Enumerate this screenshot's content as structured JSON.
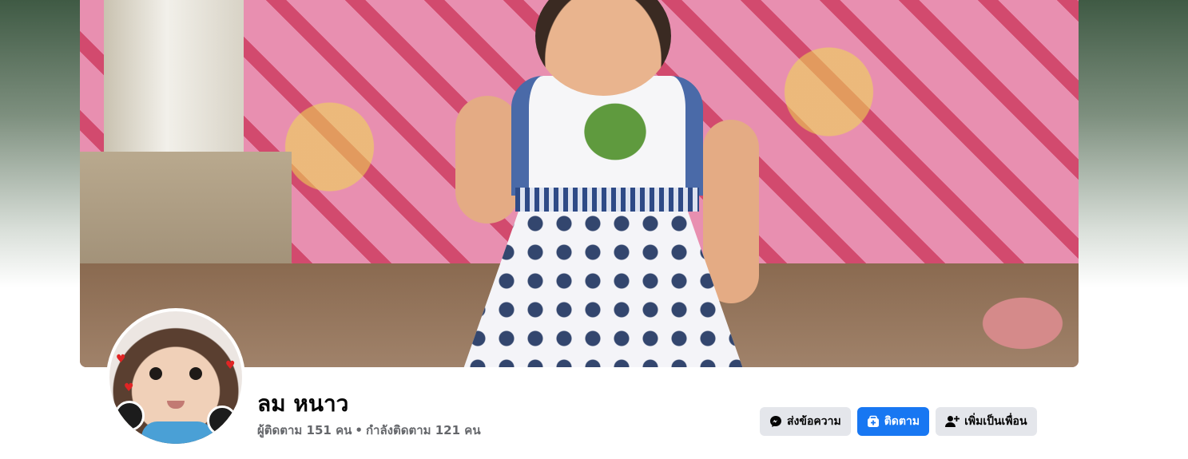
{
  "profile": {
    "name": "ลม หนาว",
    "followers_text": "ผู้ติดตาม 151 คน",
    "separator": "•",
    "following_text": "กำลังติดตาม 121 คน"
  },
  "actions": {
    "message_label": "ส่งข้อความ",
    "follow_label": "ติดตาม",
    "add_friend_label": "เพิ่มเป็นเพื่อน"
  },
  "icons": {
    "message": "messenger-icon",
    "follow": "follow-icon",
    "add_friend": "add-friend-icon"
  },
  "colors": {
    "accent": "#1877f2",
    "button_grey": "#e4e6eb",
    "secondary_text": "#65676b"
  }
}
